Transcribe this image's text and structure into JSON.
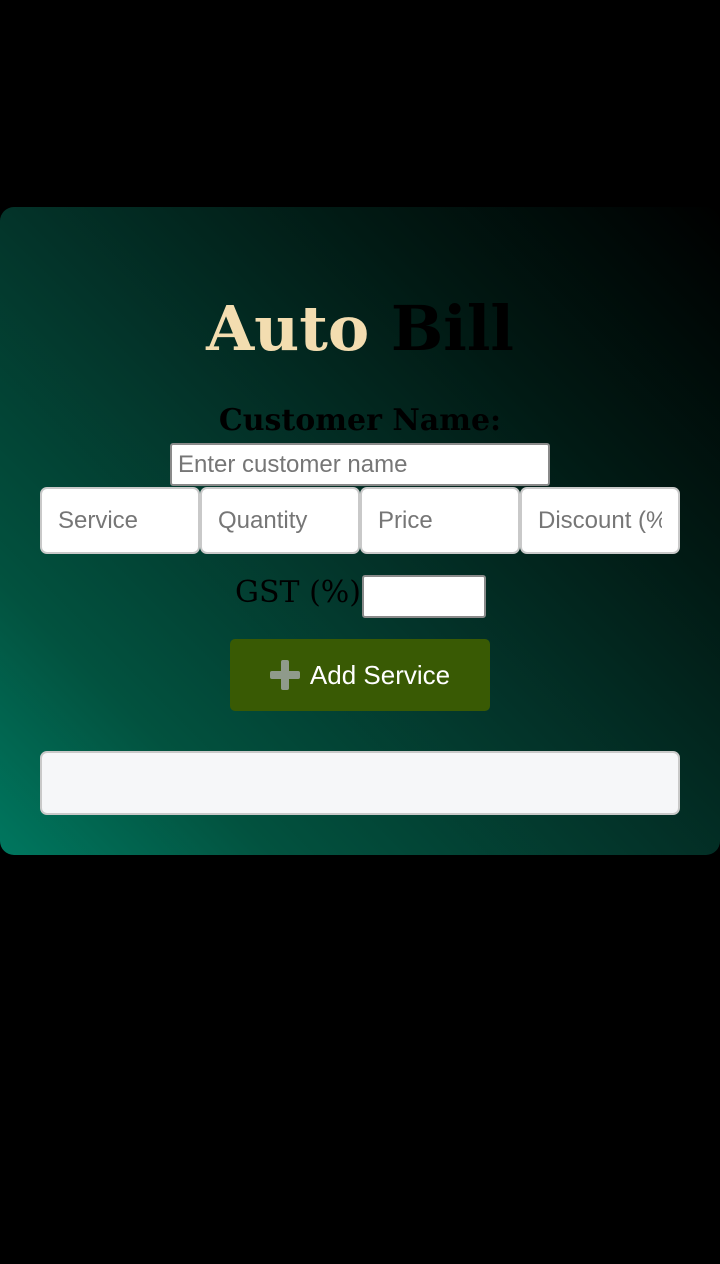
{
  "app": {
    "title_part1": "Auto",
    "title_part2": "Bill"
  },
  "customer": {
    "label": "Customer Name:",
    "placeholder": "Enter customer name",
    "value": ""
  },
  "service_fields": [
    {
      "placeholder": "Service"
    },
    {
      "placeholder": "Quantity"
    },
    {
      "placeholder": "Price"
    },
    {
      "placeholder": "Discount (%"
    }
  ],
  "gst": {
    "label": "GST (%)",
    "value": ""
  },
  "add_button": {
    "label": "Add Service",
    "icon": "plus-icon"
  },
  "output": {
    "text": ""
  },
  "colors": {
    "title_accent": "#f3ddb0",
    "button_bg": "#395a04",
    "gradient_start": "#00775f",
    "gradient_end": "#000000"
  }
}
